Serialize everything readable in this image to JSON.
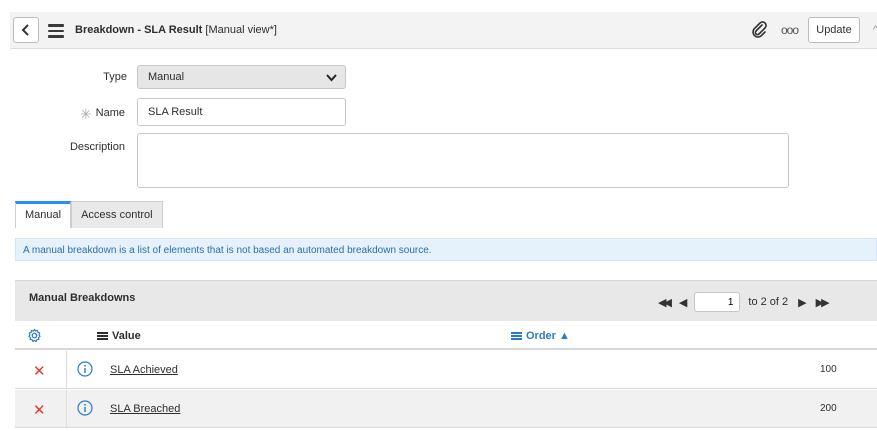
{
  "header": {
    "title_bold": "Breakdown - SLA Result",
    "title_suffix": " [Manual view*]",
    "more_label": "ooo",
    "update_label": "Update"
  },
  "form": {
    "type_label": "Type",
    "type_value": "Manual",
    "name_label": "Name",
    "name_value": "SLA Result",
    "description_label": "Description",
    "description_value": ""
  },
  "tabs": [
    {
      "label": "Manual",
      "active": true
    },
    {
      "label": "Access control",
      "active": false
    }
  ],
  "info_message": "A manual breakdown is a list of elements that is not based an automated breakdown source.",
  "related_list": {
    "title": "Manual Breakdowns",
    "current_page": "1",
    "range_text": "to 2 of 2",
    "columns": {
      "value": "Value",
      "order": "Order ▲"
    },
    "rows": [
      {
        "value": "SLA Achieved",
        "order": "100"
      },
      {
        "value": "SLA Breached",
        "order": "200"
      }
    ]
  },
  "colors": {
    "accent": "#278efc",
    "delete": "#e13d2d",
    "info_bg": "#e5f1fb",
    "link": "#2a7ac8"
  }
}
